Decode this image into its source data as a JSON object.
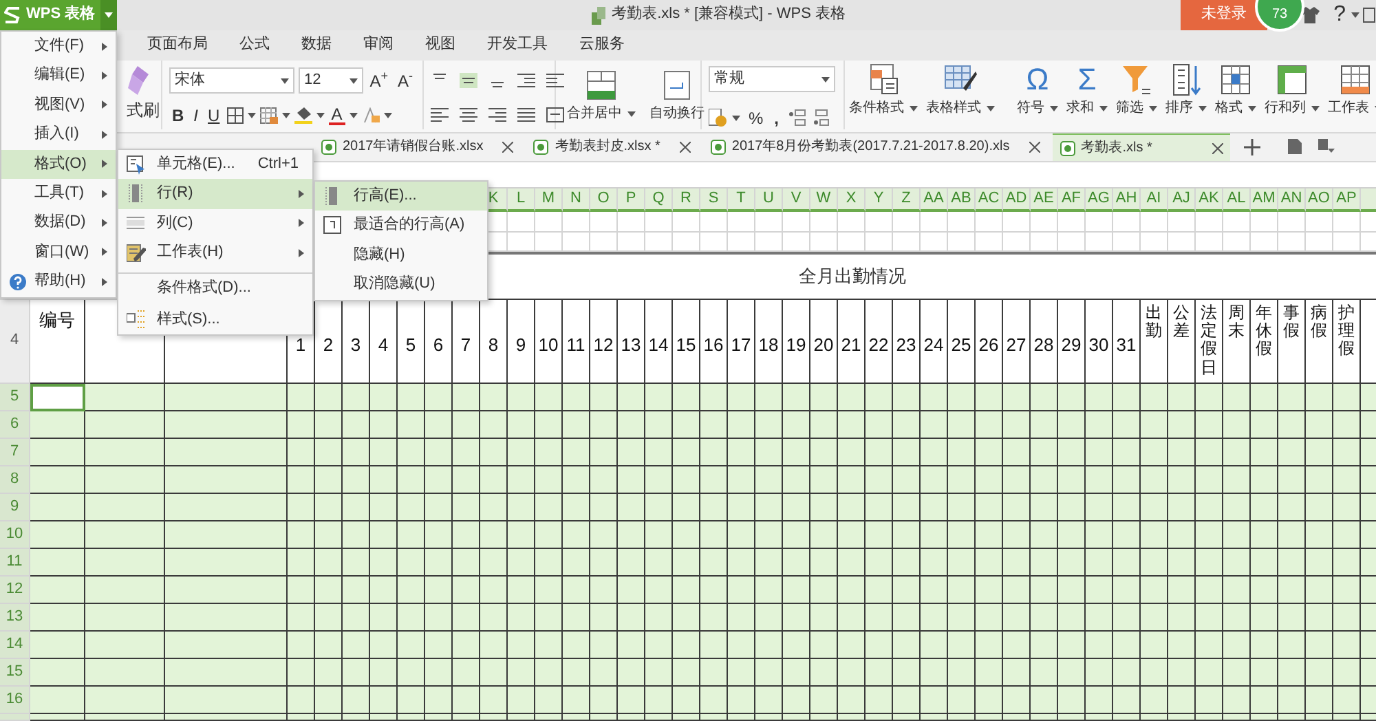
{
  "title_bar": {
    "app_label": "WPS 表格",
    "title": "考勤表.xls * [兼容模式] - WPS 表格",
    "login_button": "未登录",
    "badge": "73",
    "help_glyph": "?"
  },
  "ribbon_tabs": [
    "页面布局",
    "公式",
    "数据",
    "审阅",
    "视图",
    "开发工具",
    "云服务"
  ],
  "toolbar": {
    "format_painter": "式刷",
    "font_name": "宋体",
    "font_size": "12",
    "size_buttons": [
      "A$^{+}$",
      "A$^{-}$"
    ],
    "style_buttons": [
      "B",
      "I",
      "U"
    ],
    "font_color": "A",
    "merge": "合并居中",
    "wrap": "自动换行",
    "number_format": "常规",
    "percent": "%",
    "comma": ",",
    "big_buttons": [
      {
        "label": "条件格式",
        "kind": "conditional"
      },
      {
        "label": "表格样式",
        "kind": "table-style"
      },
      {
        "label": "符号",
        "kind": "glyph",
        "glyph": "Ω"
      },
      {
        "label": "求和",
        "kind": "glyph",
        "glyph": "Σ"
      },
      {
        "label": "筛选",
        "kind": "filter"
      },
      {
        "label": "排序",
        "kind": "sort"
      },
      {
        "label": "格式",
        "kind": "format"
      },
      {
        "label": "行和列",
        "kind": "rowcol"
      },
      {
        "label": "工作表",
        "kind": "sheet"
      }
    ]
  },
  "doc_tabs": [
    {
      "label": "2017年请销假台账.xlsx",
      "selected": false
    },
    {
      "label": "考勤表封皮.xlsx *",
      "selected": false
    },
    {
      "label": "2017年8月份考勤表(2017.7.21-2017.8.20).xls",
      "selected": false
    },
    {
      "label": "考勤表.xls *",
      "selected": true
    }
  ],
  "sheet": {
    "column_letters": [
      "K",
      "L",
      "M",
      "N",
      "O",
      "P",
      "Q",
      "R",
      "S",
      "T",
      "U",
      "V",
      "W",
      "X",
      "Y",
      "Z",
      "AA",
      "AB",
      "AC",
      "AD",
      "AE",
      "AF",
      "AG",
      "AH",
      "AI",
      "AJ",
      "AK",
      "AL",
      "AM",
      "AN",
      "AO",
      "AP"
    ],
    "title": "全月出勤情况",
    "header_row_label": "4",
    "number_header": "编号",
    "day_headers": [
      "1",
      "2",
      "3",
      "4",
      "5",
      "6",
      "7",
      "8",
      "9",
      "10",
      "11",
      "12",
      "13",
      "14",
      "15",
      "16",
      "17",
      "18",
      "19",
      "20",
      "21",
      "22",
      "23",
      "24",
      "25",
      "26",
      "27",
      "28",
      "29",
      "30",
      "31"
    ],
    "summary_headers": [
      "出勤",
      "公差",
      "法定假日",
      "周末",
      "年休假",
      "事假",
      "病假",
      "护理假"
    ],
    "rows": [
      {
        "label": "5",
        "selected": true,
        "active": true
      },
      {
        "label": "6",
        "selected": true,
        "active": false
      },
      {
        "label": "7",
        "selected": true,
        "active": false
      },
      {
        "label": "8",
        "selected": true,
        "active": false
      },
      {
        "label": "9",
        "selected": true,
        "active": false
      },
      {
        "label": "10",
        "selected": true,
        "active": false
      },
      {
        "label": "11",
        "selected": true,
        "active": false
      },
      {
        "label": "12",
        "selected": true,
        "active": false
      },
      {
        "label": "13",
        "selected": true,
        "active": false
      },
      {
        "label": "14",
        "selected": true,
        "active": false
      },
      {
        "label": "15",
        "selected": true,
        "active": false
      },
      {
        "label": "16",
        "selected": true,
        "active": false
      }
    ]
  },
  "main_menu": [
    {
      "label": "文件(F)",
      "kind": "plain",
      "selected": false
    },
    {
      "label": "编辑(E)",
      "kind": "plain",
      "selected": false
    },
    {
      "label": "视图(V)",
      "kind": "plain",
      "selected": false
    },
    {
      "label": "插入(I)",
      "kind": "plain",
      "selected": false
    },
    {
      "label": "格式(O)",
      "kind": "plain",
      "selected": true
    },
    {
      "label": "工具(T)",
      "kind": "plain",
      "selected": false
    },
    {
      "label": "数据(D)",
      "kind": "plain",
      "selected": false
    },
    {
      "label": "窗口(W)",
      "kind": "plain",
      "selected": false
    },
    {
      "label": "帮助(H)",
      "kind": "help",
      "selected": false
    }
  ],
  "format_menu": [
    {
      "label": "单元格(E)...",
      "kind": "cell",
      "shortcut": "Ctrl+1",
      "submenu": false,
      "selected": false,
      "separator_before": false
    },
    {
      "label": "行(R)",
      "kind": "row",
      "submenu": true,
      "selected": true,
      "separator_before": false
    },
    {
      "label": "列(C)",
      "kind": "column",
      "submenu": true,
      "selected": false,
      "separator_before": false
    },
    {
      "label": "工作表(H)",
      "kind": "sheet",
      "submenu": true,
      "selected": false,
      "separator_before": false
    },
    {
      "label": "条件格式(D)...",
      "kind": "none",
      "submenu": false,
      "selected": false,
      "separator_before": true
    },
    {
      "label": "样式(S)...",
      "kind": "style",
      "submenu": false,
      "selected": false,
      "separator_before": false
    }
  ],
  "row_menu": [
    {
      "label": "行高(E)...",
      "kind": "row-height",
      "selected": true
    },
    {
      "label": "最适合的行高(A)",
      "kind": "autofit",
      "selected": false
    },
    {
      "label": "隐藏(H)",
      "kind": "none",
      "selected": false
    },
    {
      "label": "取消隐藏(U)",
      "kind": "none",
      "selected": false
    }
  ]
}
